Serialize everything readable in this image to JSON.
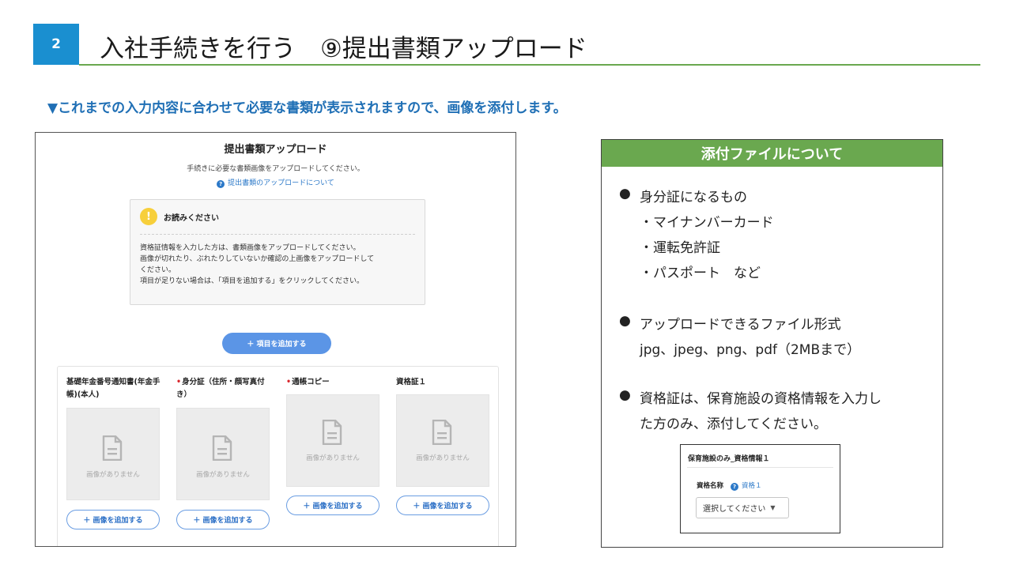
{
  "header": {
    "badge": "2",
    "title": "入社手続きを行う　⑨提出書類アップロード"
  },
  "lead": "▼これまでの入力内容に合わせて必要な書類が表示されますので、画像を添付します。",
  "screen": {
    "title": "提出書類アップロード",
    "subtitle": "手続きに必要な書類画像をアップロードしてください。",
    "help_link": "提出書類のアップロードについて",
    "notice": {
      "title": "お読みください",
      "lines": [
        "資格証情報を入力した方は、書類画像をアップロードしてください。",
        "画像が切れたり、ぶれたりしていないか確認の上画像をアップロードして",
        "ください。",
        "項目が足りない場合は、「項目を追加する」をクリックしてください。"
      ]
    },
    "add_item_button": "＋ 項目を追加する",
    "documents": [
      {
        "label": "基礎年金番号通知書(年金手帳)(本人)",
        "required": false,
        "placeholder": "画像がありません",
        "button": "＋ 画像を追加する"
      },
      {
        "label": "身分証（住所・顔写真付き）",
        "required": true,
        "placeholder": "画像がありません",
        "button": "＋ 画像を追加する"
      },
      {
        "label": "通帳コピー",
        "required": true,
        "placeholder": "画像がありません",
        "button": "＋ 画像を追加する"
      },
      {
        "label": "資格証１",
        "required": false,
        "placeholder": "画像がありません",
        "button": "＋ 画像を追加する"
      }
    ]
  },
  "panel": {
    "title": "添付ファイルについて",
    "bullet_mark": "●",
    "sections": [
      {
        "lines": [
          "身分証になるもの",
          "・マイナンバーカード",
          "・運転免許証",
          "・パスポート　など"
        ]
      },
      {
        "lines": [
          "アップロードできるファイル形式",
          "jpg、jpeg、png、pdf（2MBまで）"
        ]
      },
      {
        "lines": [
          "資格証は、保育施設の資格情報を入力し",
          "た方のみ、添付してください。"
        ]
      }
    ],
    "example": {
      "title": "保育施設のみ_資格情報１",
      "field_label": "資格名称",
      "field_link": "資格１",
      "select_value": "選択してください"
    }
  }
}
